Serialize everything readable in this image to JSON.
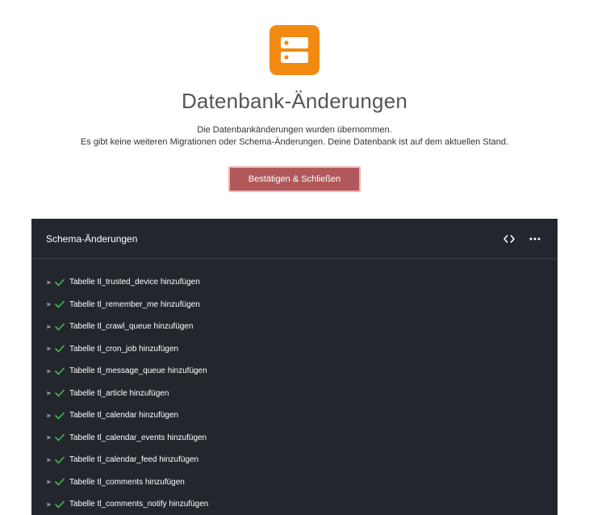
{
  "header": {
    "title": "Datenbank-Änderungen",
    "message_line1": "Die Datenbankänderungen wurden übernommen.",
    "message_line2": "Es gibt keine weiteren Migrationen oder Schema-Änderungen. Deine Datenbank ist auf dem aktuellen Stand.",
    "icon": "database-server-icon",
    "icon_color": "#f28a12"
  },
  "confirm_button": {
    "label": "Bestätigen & Schließen",
    "color": "#b0585a"
  },
  "schema_panel": {
    "title": "Schema-Änderungen",
    "actions": [
      "code-icon",
      "more-icon"
    ],
    "items": [
      {
        "label": "Tabelle tl_trusted_device hinzufügen",
        "status": "success"
      },
      {
        "label": "Tabelle tl_remember_me hinzufügen",
        "status": "success"
      },
      {
        "label": "Tabelle tl_crawl_queue hinzufügen",
        "status": "success"
      },
      {
        "label": "Tabelle tl_cron_job hinzufügen",
        "status": "success"
      },
      {
        "label": "Tabelle tl_message_queue hinzufügen",
        "status": "success"
      },
      {
        "label": "Tabelle tl_article hinzufügen",
        "status": "success"
      },
      {
        "label": "Tabelle tl_calendar hinzufügen",
        "status": "success"
      },
      {
        "label": "Tabelle tl_calendar_events hinzufügen",
        "status": "success"
      },
      {
        "label": "Tabelle tl_calendar_feed hinzufügen",
        "status": "success"
      },
      {
        "label": "Tabelle tl_comments hinzufügen",
        "status": "success"
      },
      {
        "label": "Tabelle tl_comments_notify hinzufügen",
        "status": "success"
      }
    ],
    "success_color": "#3fb950"
  }
}
